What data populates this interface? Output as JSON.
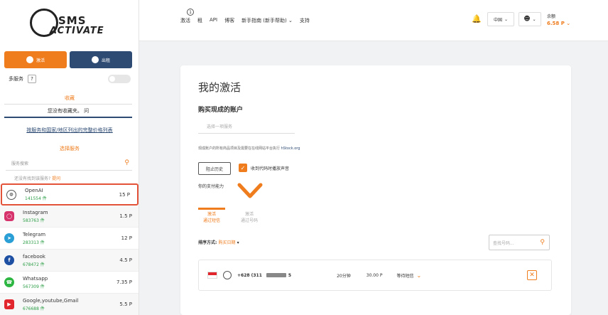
{
  "sidebar": {
    "logo_line1": "SMS",
    "logo_line2": "ACTIVATE",
    "tab_activate": "激活",
    "tab_rent": "出租",
    "multi_label": "多服务",
    "help": "?",
    "fav_title": "收藏",
    "fav_empty": "您没有收藏夹。 问",
    "price_link": "按服务和国家/地区列出的完整价格列表",
    "select_title": "选择服务",
    "search_placeholder": "服务搜索",
    "not_found": "还没有找到该服务?",
    "not_found_link": "提问",
    "services": [
      {
        "name": "OpenAI",
        "count": "141554 件",
        "price": "15 P",
        "icon_color": "#555555",
        "icon": "openai-icon"
      },
      {
        "name": "Instagram",
        "count": "583763 件",
        "price": "1.5 P",
        "icon_color": "#d6336c",
        "icon": "instagram-icon"
      },
      {
        "name": "Telegram",
        "count": "283313 件",
        "price": "12 P",
        "icon_color": "#2a9fd6",
        "icon": "telegram-icon"
      },
      {
        "name": "facebook",
        "count": "678472 件",
        "price": "4.5 P",
        "icon_color": "#1d4fa3",
        "icon": "facebook-icon"
      },
      {
        "name": "Whatsapp",
        "count": "567309 件",
        "price": "7.35 P",
        "icon_color": "#2db742",
        "icon": "whatsapp-icon"
      },
      {
        "name": "Google,youtube,Gmail",
        "count": "676688 件",
        "price": "5.5 P",
        "icon_color": "#e2262e",
        "icon": "google-icon"
      }
    ]
  },
  "topbar": {
    "nav": [
      "激活",
      "租",
      "API",
      "博客",
      "新手指南 (新手帮助)",
      "支持"
    ],
    "badge": "1",
    "language": "中国",
    "user_name": "余额",
    "balance": "6.58 P"
  },
  "main": {
    "title": "我的激活",
    "buy_title": "购买现成的账户",
    "buy_placeholder": "选择一项服务",
    "notice": "现成账户的所有商品项目及需要在在线网站平台执行",
    "notice_link": "hStock.org",
    "history_button": "阻止历史",
    "sound_label": "收到代码时播放声音",
    "pay_label": "你的支付能力",
    "tabs": [
      {
        "line1": "激活",
        "line2": "通过短信"
      },
      {
        "line1": "激活",
        "line2": "通过号码"
      }
    ],
    "sort_label": "排序方式:",
    "sort_value": "购买日期",
    "num_search_placeholder": "查找号码...",
    "order": {
      "phone": "+628 (311",
      "phone_tail": "5",
      "time": "20分钟",
      "cost": "30.00 P",
      "status": "等待短信"
    }
  },
  "colors": {
    "accent": "#ef7d1e",
    "navy": "#2e4b73",
    "highlight": "#e2533a"
  }
}
